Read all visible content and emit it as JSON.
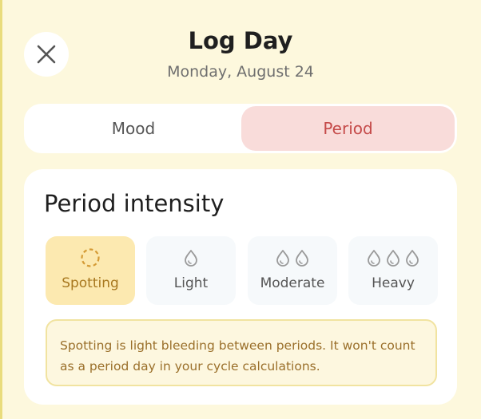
{
  "header": {
    "title": "Log Day",
    "date": "Monday, August 24",
    "close_icon": "close-icon"
  },
  "tabs": [
    {
      "label": "Mood",
      "active": false
    },
    {
      "label": "Period",
      "active": true
    }
  ],
  "intensity": {
    "heading": "Period intensity",
    "selected": "Spotting",
    "options": [
      {
        "label": "Spotting",
        "icon": "dashed-circle-icon"
      },
      {
        "label": "Light",
        "icon": "droplet-icon"
      },
      {
        "label": "Moderate",
        "icon": "two-droplets-icon"
      },
      {
        "label": "Heavy",
        "icon": "three-droplets-icon"
      }
    ],
    "note": "Spotting is light bleeding between periods. It won't count as a period day in your cycle calculations."
  },
  "colors": {
    "background": "#fdf8dd",
    "active_tab_bg": "#f9dcda",
    "active_tab_text": "#c54a49",
    "selected_option_bg": "#fce9b0",
    "selected_option_text": "#a8781f",
    "note_text": "#9a6f2a"
  }
}
